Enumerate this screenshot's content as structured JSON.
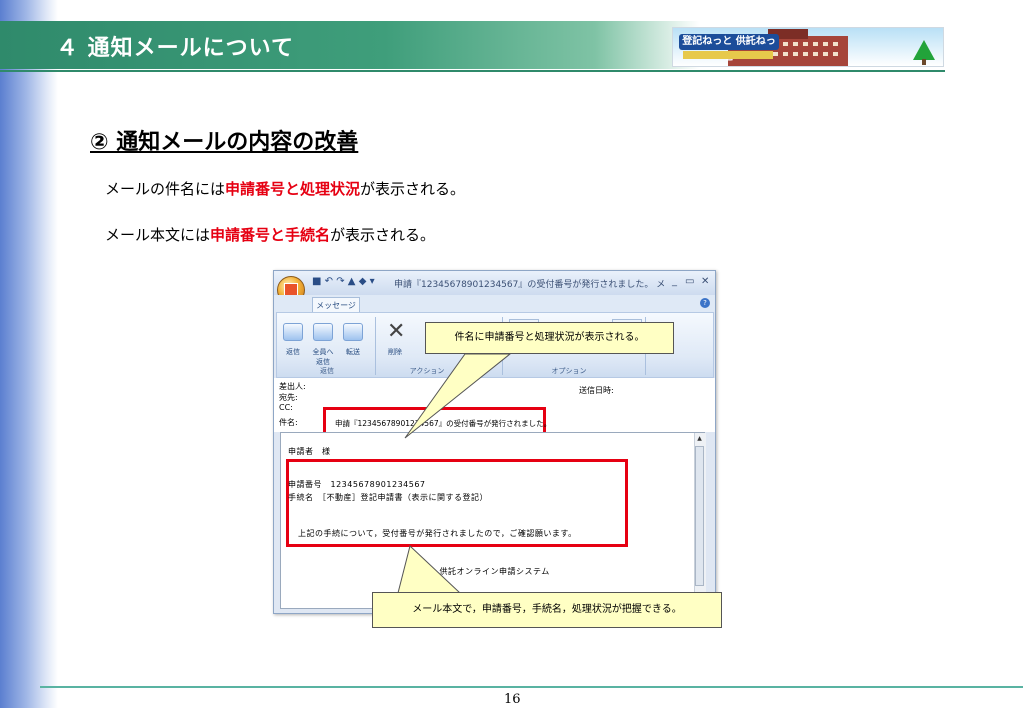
{
  "header": {
    "title": "４  通知メールについて",
    "banner_logo": "登記ねっと 供託ねっと"
  },
  "section": {
    "title": "②  通知メールの内容の改善"
  },
  "lines": [
    {
      "before": "メールの件名には",
      "highlight": "申請番号と処理状況",
      "after": "が表示される。"
    },
    {
      "before": "メール本文には",
      "highlight": "申請番号と手続名",
      "after": "が表示される。"
    }
  ],
  "mail_window": {
    "title": "申請『12345678901234567』の受付番号が発行されました。 メ",
    "tab": "メッセージ",
    "ribbon": {
      "buttons": [
        {
          "label": "返信"
        },
        {
          "label": "全員へ\n返信"
        },
        {
          "label": "転送"
        },
        {
          "label": "削除"
        }
      ],
      "groups": [
        "返信",
        "アクション",
        "オプション"
      ]
    },
    "headers": {
      "from": "差出人:",
      "to": "宛先:",
      "cc": "CC:",
      "subject_label": "件名:",
      "sent": "送信日時:",
      "subject_value": "申請『12345678901234567』の受付番号が発行されました。"
    },
    "body": {
      "greeting": "申請者　様",
      "app_number": "申請番号　12345678901234567",
      "procedure": "手続名　［不動産］登記申請書（表示に関する登記）",
      "notice": "上記の手続について，受付番号が発行されましたので，ご確認願います。",
      "signature": "登記・供託オンライン申請システム"
    }
  },
  "callouts": {
    "subject": "件名に申請番号と処理状況が表示される。",
    "body": "メール本文で，申請番号，手続名，処理状況が把握できる。"
  },
  "footer": {
    "page": "16"
  },
  "colors": {
    "header_green": "#2f8a6b",
    "highlight_red": "#e60012",
    "callout_yellow": "#ffffc4"
  }
}
